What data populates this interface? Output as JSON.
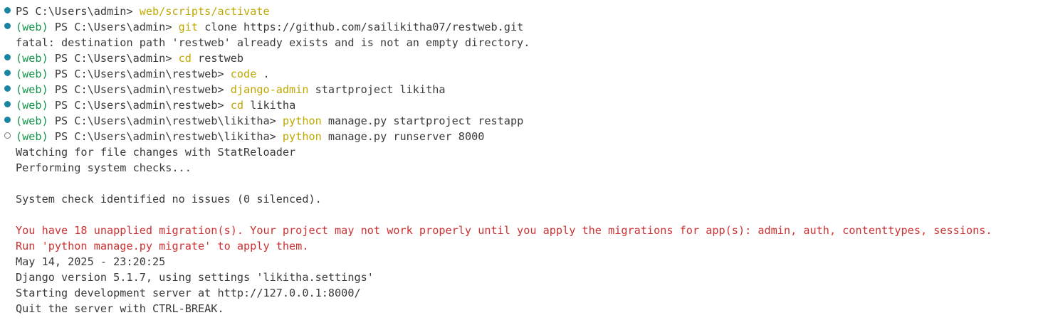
{
  "colors": {
    "background": "#ffffff",
    "text": "#3b3b3b",
    "venv_prefix": "#119649",
    "command": "#bfa800",
    "error": "#cd3131",
    "marker_success": "#1a85a0",
    "marker_running": "#7a7a7a"
  },
  "terminal": {
    "lines": [
      {
        "marker": "success",
        "venv": "",
        "prompt": "PS C:\\Users\\admin> ",
        "cmd": "web/scripts/activate",
        "args": "",
        "text": ""
      },
      {
        "marker": "success",
        "venv": "(web) ",
        "prompt": "PS C:\\Users\\admin> ",
        "cmd": "git",
        "args": " clone https://github.com/sailikitha07/restweb.git",
        "text": ""
      },
      {
        "marker": "",
        "venv": "",
        "prompt": "",
        "cmd": "",
        "args": "",
        "text": "fatal: destination path 'restweb' already exists and is not an empty directory."
      },
      {
        "marker": "success",
        "venv": "(web) ",
        "prompt": "PS C:\\Users\\admin> ",
        "cmd": "cd",
        "args": " restweb",
        "text": ""
      },
      {
        "marker": "success",
        "venv": "(web) ",
        "prompt": "PS C:\\Users\\admin\\restweb> ",
        "cmd": "code",
        "args": " .",
        "text": ""
      },
      {
        "marker": "success",
        "venv": "(web) ",
        "prompt": "PS C:\\Users\\admin\\restweb> ",
        "cmd": "django-admin",
        "args": " startproject likitha",
        "text": ""
      },
      {
        "marker": "success",
        "venv": "(web) ",
        "prompt": "PS C:\\Users\\admin\\restweb> ",
        "cmd": "cd",
        "args": " likitha",
        "text": ""
      },
      {
        "marker": "success",
        "venv": "(web) ",
        "prompt": "PS C:\\Users\\admin\\restweb\\likitha> ",
        "cmd": "python",
        "args": " manage.py startproject restapp",
        "text": ""
      },
      {
        "marker": "running",
        "venv": "(web) ",
        "prompt": "PS C:\\Users\\admin\\restweb\\likitha> ",
        "cmd": "python",
        "args": " manage.py runserver 8000",
        "text": ""
      },
      {
        "marker": "",
        "venv": "",
        "prompt": "",
        "cmd": "",
        "args": "",
        "text": "Watching for file changes with StatReloader"
      },
      {
        "marker": "",
        "venv": "",
        "prompt": "",
        "cmd": "",
        "args": "",
        "text": "Performing system checks..."
      },
      {
        "marker": "",
        "venv": "",
        "prompt": "",
        "cmd": "",
        "args": "",
        "text": ""
      },
      {
        "marker": "",
        "venv": "",
        "prompt": "",
        "cmd": "",
        "args": "",
        "text": "System check identified no issues (0 silenced)."
      },
      {
        "marker": "",
        "venv": "",
        "prompt": "",
        "cmd": "",
        "args": "",
        "text": ""
      },
      {
        "marker": "",
        "venv": "",
        "prompt": "",
        "cmd": "",
        "args": "",
        "text": "You have 18 unapplied migration(s). Your project may not work properly until you apply the migrations for app(s): admin, auth, contenttypes, sessions.",
        "style": "error"
      },
      {
        "marker": "",
        "venv": "",
        "prompt": "",
        "cmd": "",
        "args": "",
        "text": "Run 'python manage.py migrate' to apply them.",
        "style": "error"
      },
      {
        "marker": "",
        "venv": "",
        "prompt": "",
        "cmd": "",
        "args": "",
        "text": "May 14, 2025 - 23:20:25"
      },
      {
        "marker": "",
        "venv": "",
        "prompt": "",
        "cmd": "",
        "args": "",
        "text": "Django version 5.1.7, using settings 'likitha.settings'"
      },
      {
        "marker": "",
        "venv": "",
        "prompt": "",
        "cmd": "",
        "args": "",
        "text": "Starting development server at http://127.0.0.1:8000/"
      },
      {
        "marker": "",
        "venv": "",
        "prompt": "",
        "cmd": "",
        "args": "",
        "text": "Quit the server with CTRL-BREAK."
      }
    ]
  }
}
